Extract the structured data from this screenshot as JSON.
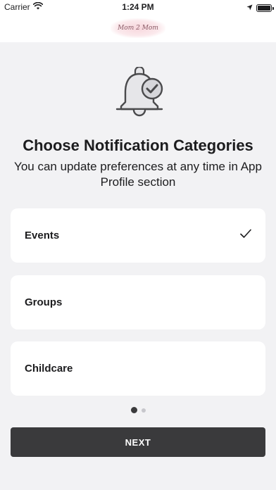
{
  "status_bar": {
    "carrier": "Carrier",
    "time": "1:24 PM"
  },
  "header": {
    "logo_text": "Mom 2 Mom"
  },
  "main": {
    "title": "Choose Notification Categories",
    "subtitle": "You can update preferences at any time in App Profile section",
    "categories": [
      {
        "label": "Events",
        "selected": true
      },
      {
        "label": "Groups",
        "selected": false
      },
      {
        "label": "Childcare",
        "selected": false
      }
    ]
  },
  "pager": {
    "page": 1,
    "total": 2
  },
  "footer": {
    "next_label": "NEXT"
  },
  "colors": {
    "background": "#f2f2f4",
    "card": "#ffffff",
    "button": "#3a3a3c",
    "logo_accent": "#f7d6dc"
  }
}
